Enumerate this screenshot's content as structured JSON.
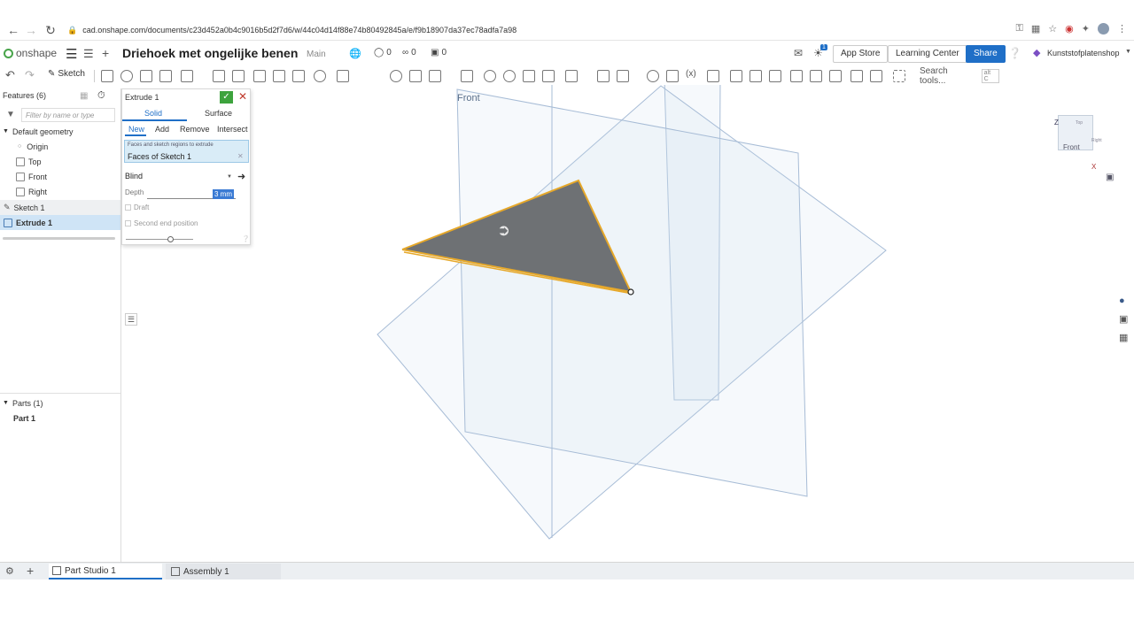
{
  "browser": {
    "url": "cad.onshape.com/documents/c23d452a0b4c9016b5d2f7d6/w/44c04d14f88e74b80492845a/e/f9b18907da37ec78adfa7a98"
  },
  "header": {
    "logo_text": "onshape",
    "doc_title": "Driehoek met ongelijke benen",
    "branch": "Main",
    "likes": "0",
    "links": "0",
    "copies": "0",
    "notif_badge": "1",
    "app_store": "App Store",
    "learning_center": "Learning Center",
    "share": "Share",
    "user": "Kunststofplatenshop"
  },
  "toolbar": {
    "sketch_label": "Sketch",
    "search_placeholder": "Search tools...",
    "search_shortcut": "alt C"
  },
  "features": {
    "header": "Features (6)",
    "filter_placeholder": "Filter by name or type",
    "default_geometry": "Default geometry",
    "items": [
      "Origin",
      "Top",
      "Front",
      "Right"
    ],
    "sketch": "Sketch 1",
    "extrude": "Extrude 1"
  },
  "parts": {
    "header": "Parts (1)",
    "items": [
      "Part 1"
    ]
  },
  "dialog": {
    "title": "Extrude 1",
    "tab_solid": "Solid",
    "tab_surface": "Surface",
    "op_new": "New",
    "op_add": "Add",
    "op_remove": "Remove",
    "op_intersect": "Intersect",
    "selection_hint": "Faces and sketch regions to extrude",
    "selection_value": "Faces of Sketch 1",
    "end_type": "Blind",
    "depth_label": "Depth",
    "depth_value": "3 mm",
    "draft": "Draft",
    "second_end": "Second end position"
  },
  "viewport": {
    "plane_label": "Front",
    "viewcube_front": "Front",
    "viewcube_top": "Top",
    "viewcube_right": "Right",
    "axis_z": "Z",
    "axis_x": "X",
    "colors": {
      "plane_stroke": "#a7bcd6",
      "plane_fill": "rgba(205,220,238,0.18)",
      "triangle_fill": "#6e7174",
      "triangle_edge": "#e6a82a"
    }
  },
  "tabs": {
    "part_studio": "Part Studio 1",
    "assembly": "Assembly 1"
  }
}
